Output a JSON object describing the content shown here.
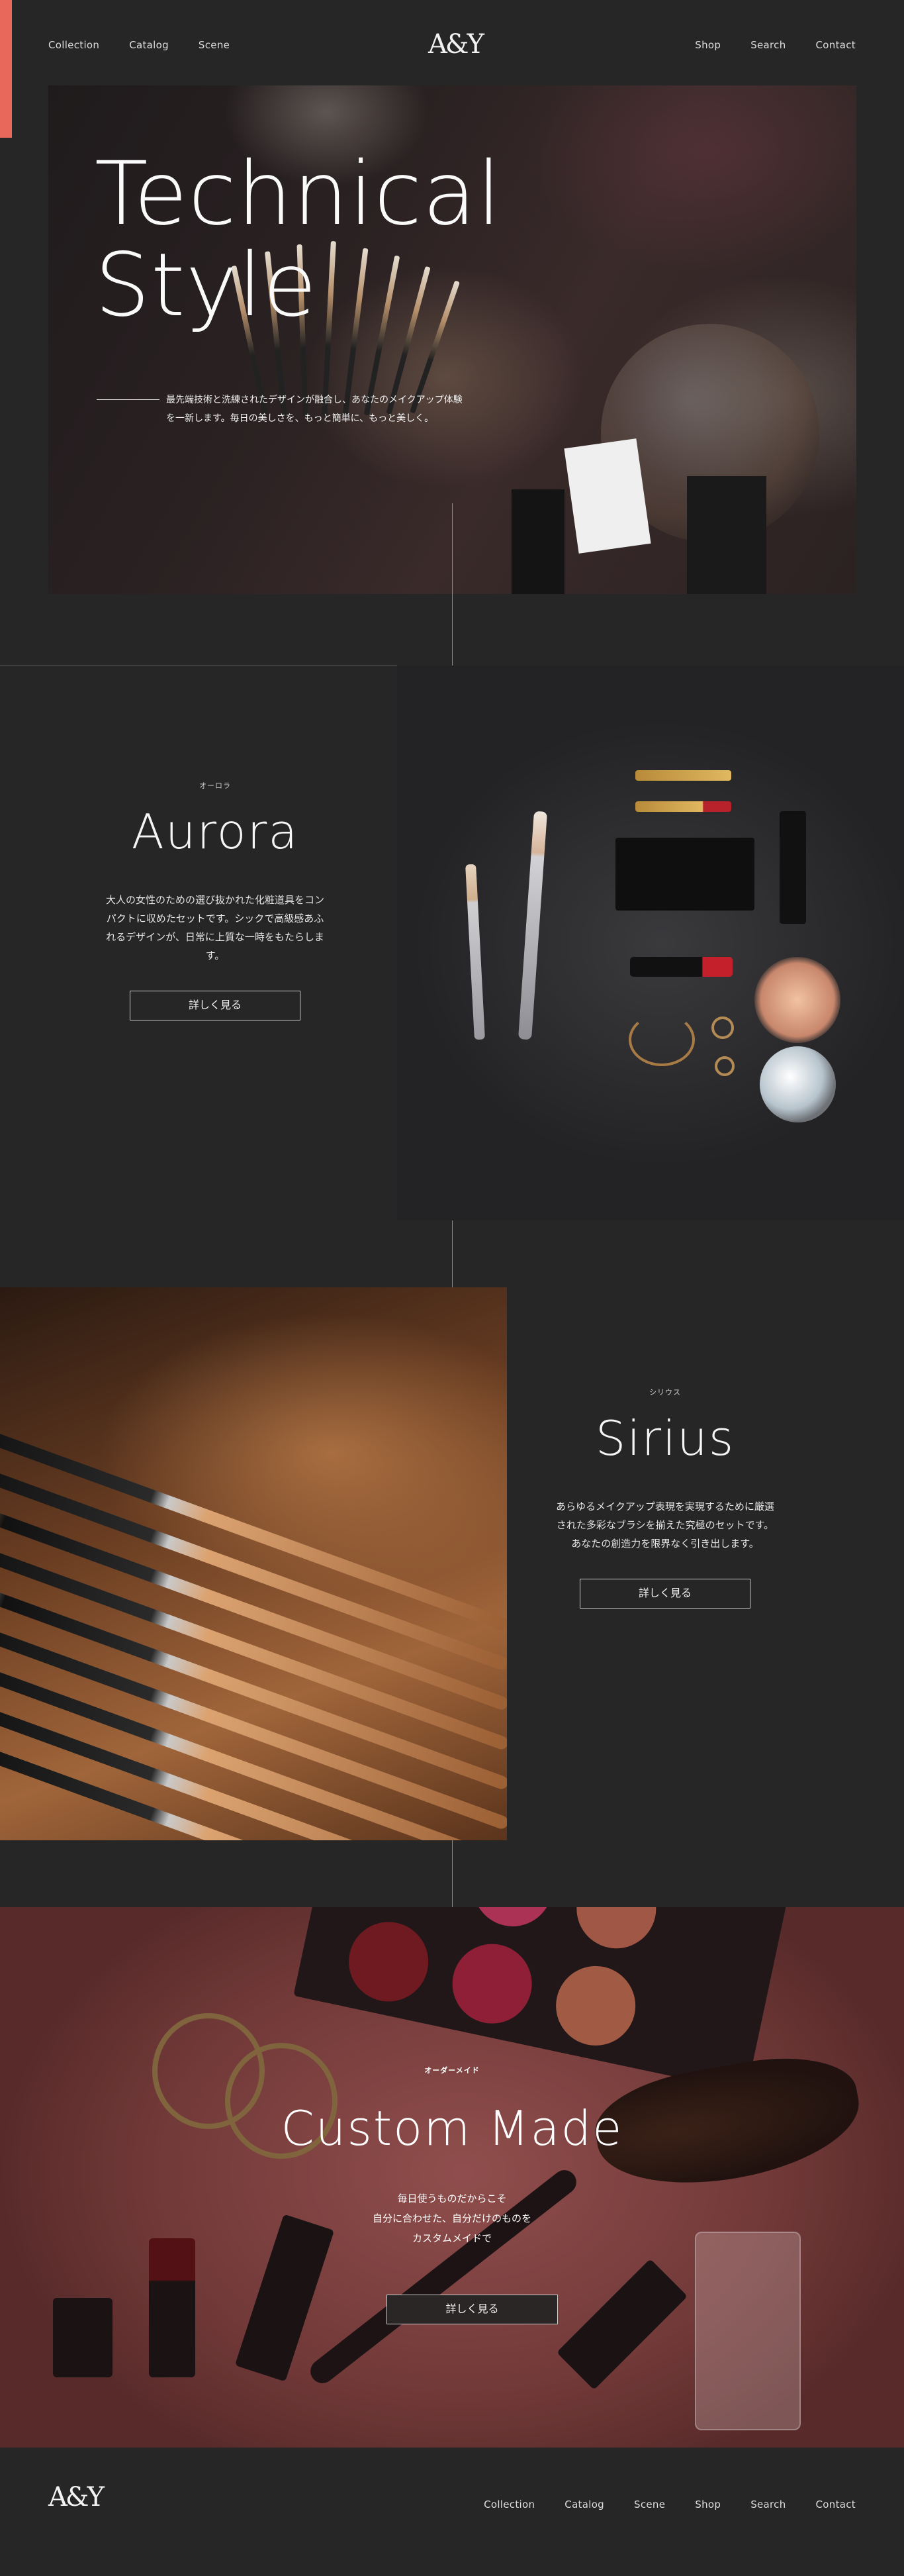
{
  "brand": {
    "logo": "A&Y"
  },
  "header": {
    "nav_left": [
      "Collection",
      "Catalog",
      "Scene"
    ],
    "nav_right": [
      "Shop",
      "Search",
      "Contact"
    ]
  },
  "hero": {
    "title_line1": "Technical",
    "title_line2": "Style",
    "desc_line1": "最先端技術と洗練されたデザインが融合し、あなたのメイクアップ体験",
    "desc_line2": "を一新します。毎日の美しさを、もっと簡単に、もっと美しく。"
  },
  "aurora": {
    "kana": "オーロラ",
    "title": "Aurora",
    "desc": "大人の女性のための選び抜かれた化粧道具をコンパクトに収めたセットです。シックで高級感あふれるデザインが、日常に上質な一時をもたらします。",
    "button": "詳しく見る"
  },
  "sirius": {
    "kana": "シリウス",
    "title": "Sirius",
    "desc": "あらゆるメイクアップ表現を実現するために厳選された多彩なブラシを揃えた究極のセットです。あなたの創造力を限界なく引き出します。",
    "button": "詳しく見る"
  },
  "custom": {
    "kana": "オーダーメイド",
    "title": "Custom Made",
    "desc_line1": "毎日使うものだからこそ",
    "desc_line2": "自分に合わせた、自分だけのものを",
    "desc_line3": "カスタムメイドで",
    "button": "詳しく見る"
  },
  "footer": {
    "logo": "A&Y",
    "nav": [
      "Collection",
      "Catalog",
      "Scene",
      "Shop",
      "Search",
      "Contact"
    ]
  },
  "colors": {
    "accent": "#e8695c",
    "background": "#262626"
  }
}
